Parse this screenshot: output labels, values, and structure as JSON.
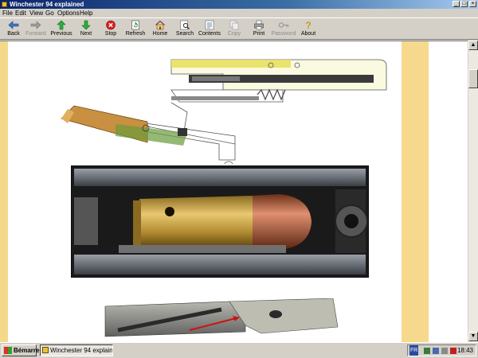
{
  "window": {
    "title": "Winchester 94 explained"
  },
  "menu": [
    "File",
    "Edit",
    "View",
    "Go",
    "Options",
    "Help"
  ],
  "toolbar": {
    "back": "Back",
    "forward": "Forward",
    "previous": "Previous",
    "next": "Next",
    "stop": "Stop",
    "refresh": "Refresh",
    "home": "Home",
    "search": "Search",
    "contents": "Contents",
    "copy": "Copy",
    "print": "Print",
    "password": "Password",
    "about": "About"
  },
  "taskbar": {
    "start": "Bémarrer",
    "item": "Winchester 94 explain...",
    "lang": "FR",
    "clock": "18:43"
  },
  "colors": {
    "sidebar": "#f7d98e",
    "titlebar": "#0a246a",
    "brass": "#c9a04a"
  }
}
